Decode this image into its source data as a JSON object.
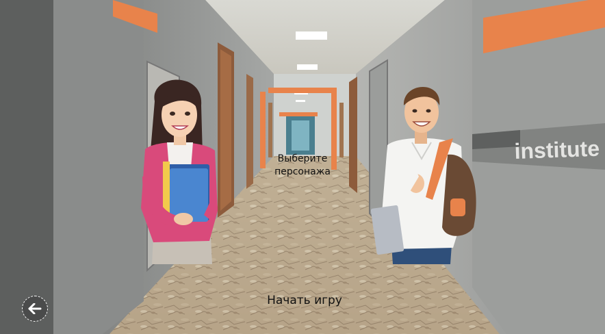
{
  "screen": {
    "prompt_line1": "Выберите",
    "prompt_line2": "персонажа",
    "start_label": "Начать игру",
    "wall_sign": "institute"
  },
  "characters": [
    {
      "id": "female",
      "icon": "female-student-icon"
    },
    {
      "id": "male",
      "icon": "male-student-icon"
    }
  ],
  "back": {
    "icon": "arrow-left-icon"
  },
  "colors": {
    "accent_orange": "#e8834b",
    "wall_gray": "#8f9190",
    "floor": "#b9a689"
  }
}
